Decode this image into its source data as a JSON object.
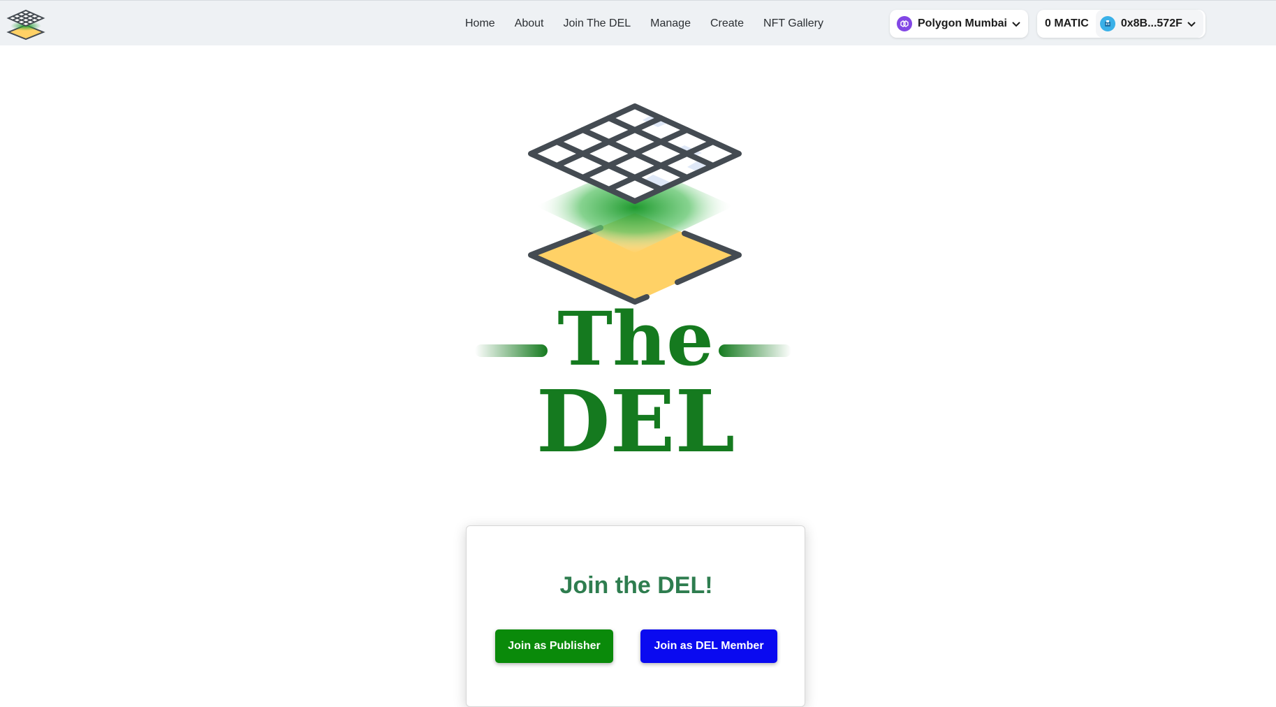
{
  "navbar": {
    "logo_icon": "the-del-logo-icon",
    "links": [
      {
        "label": "Home"
      },
      {
        "label": "About"
      },
      {
        "label": "Join The DEL"
      },
      {
        "label": "Manage"
      },
      {
        "label": "Create"
      },
      {
        "label": "NFT Gallery"
      }
    ],
    "network": {
      "icon": "polygon-icon",
      "label": "Polygon Mumbai",
      "icon_color": "#8247e5"
    },
    "wallet": {
      "balance": "0 MATIC",
      "avatar_icon": "wallet-avatar-icon",
      "address": "0x8B...572F"
    }
  },
  "hero": {
    "logo_icon": "the-del-hero-logo",
    "title_line1": "The",
    "title_line2": "DEL",
    "brand_color": "#157a1f"
  },
  "join_card": {
    "title": "Join the DEL!",
    "publisher_button": "Join as Publisher",
    "member_button": "Join as DEL Member",
    "publisher_color": "#0a8a0a",
    "member_color": "#0a0af0"
  }
}
